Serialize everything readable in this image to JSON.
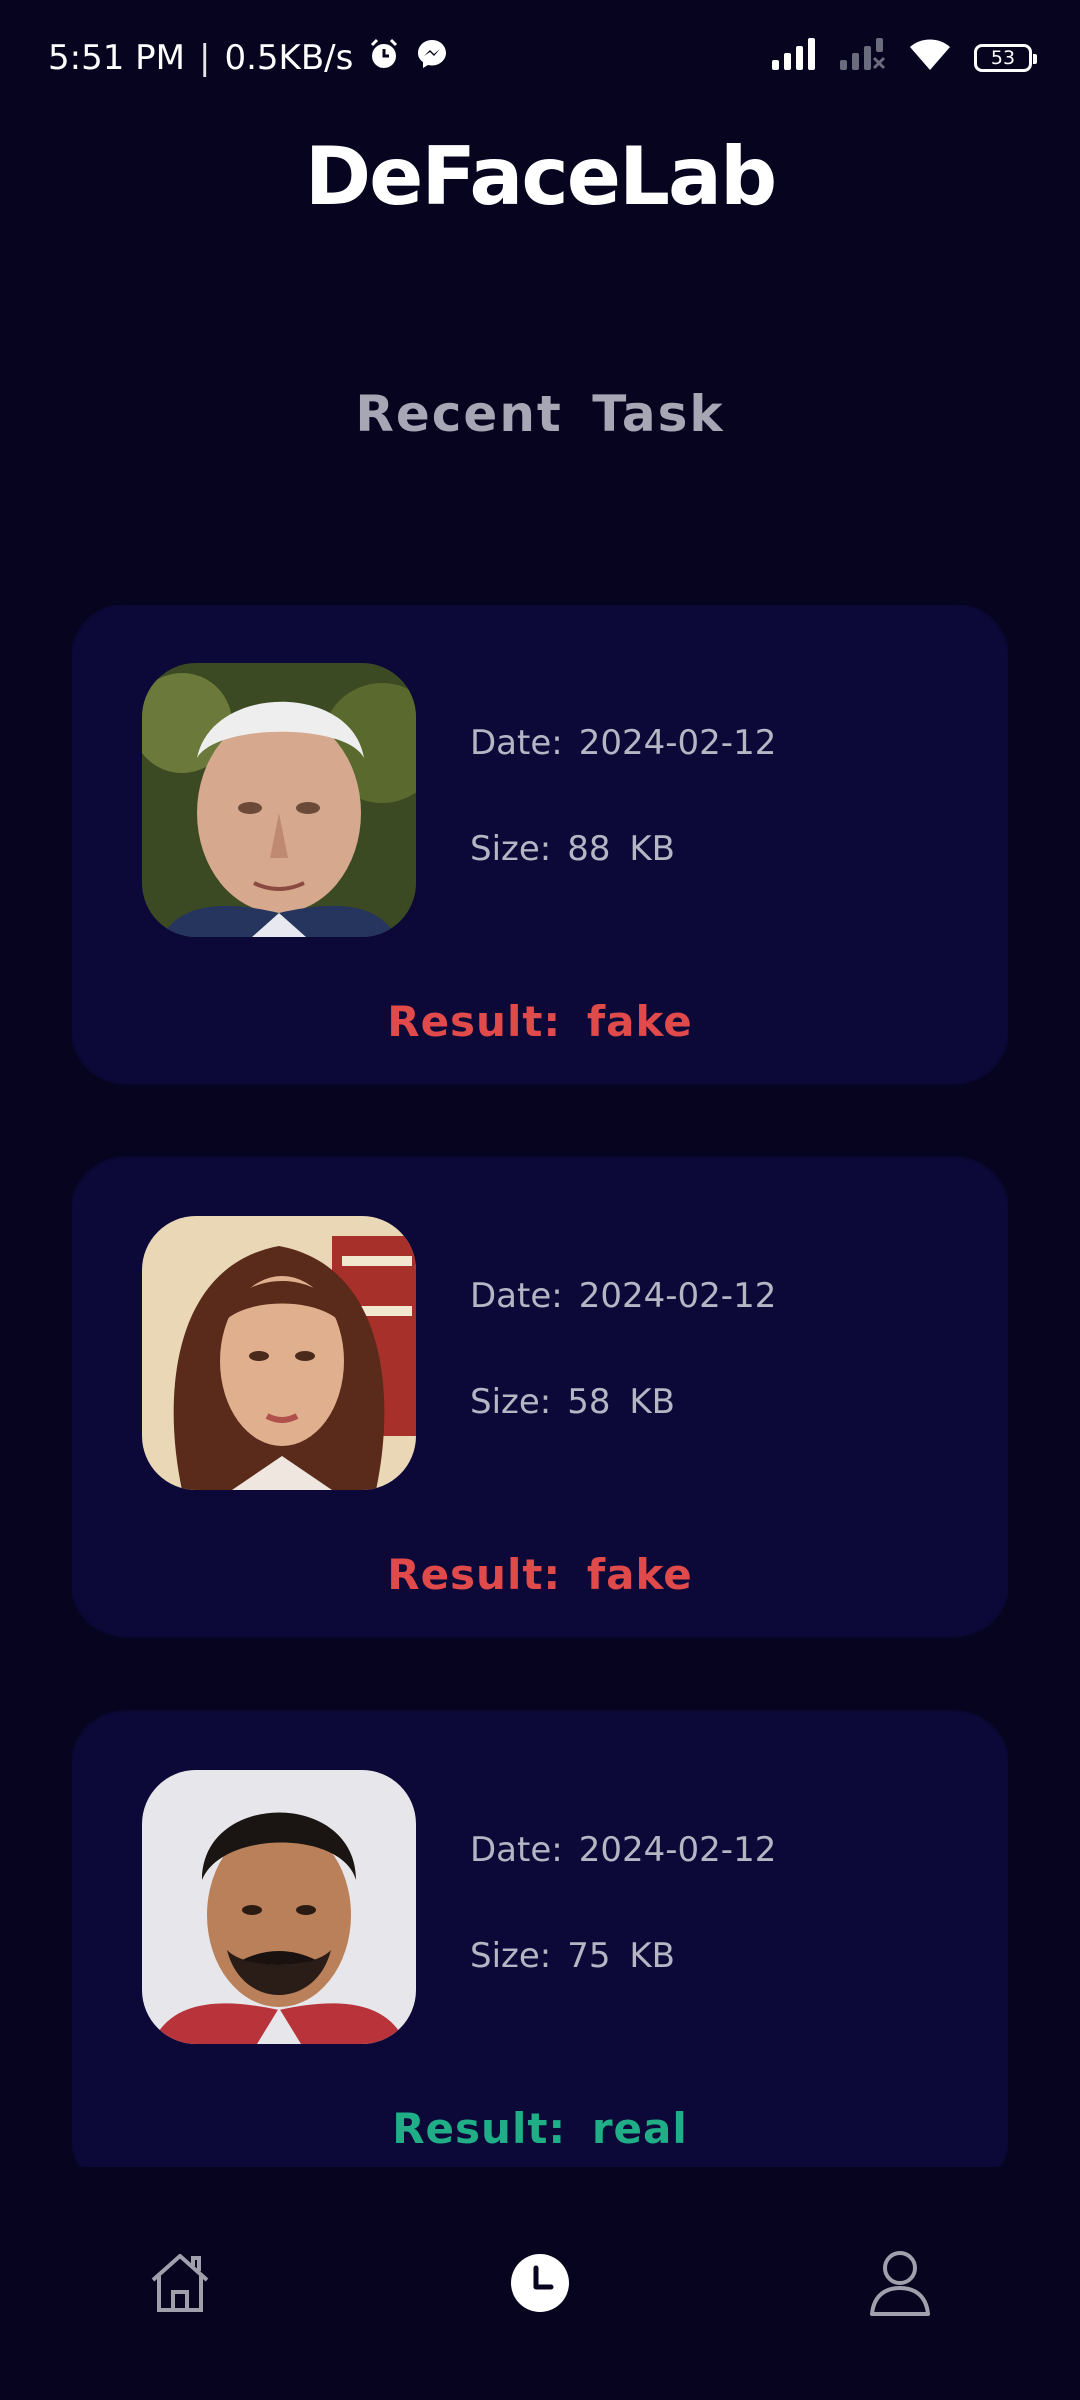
{
  "status_bar": {
    "time": "5:51 PM",
    "separator": "|",
    "net_speed": "0.5KB/s",
    "icons": [
      "alarm-icon",
      "messenger-icon",
      "signal-icon",
      "signal-off-icon",
      "wifi-icon"
    ],
    "battery": "53"
  },
  "app": {
    "title": "DeFaceLab"
  },
  "section": {
    "title": "Recent Task"
  },
  "labels": {
    "date": "Date:",
    "size": "Size:",
    "result": "Result:"
  },
  "tasks": [
    {
      "date": "2024-02-12",
      "size": "88 KB",
      "result": "fake",
      "result_color": "#e04a4a",
      "thumb_icon": "elderly-man-photo"
    },
    {
      "date": "2024-02-12",
      "size": "58 KB",
      "result": "fake",
      "result_color": "#e04a4a",
      "thumb_icon": "woman-portrait-photo"
    },
    {
      "date": "2024-02-12",
      "size": "75 KB",
      "result": "real",
      "result_color": "#1fae86",
      "thumb_icon": "bearded-man-photo"
    }
  ],
  "nav": {
    "items": [
      {
        "icon": "home-icon",
        "active": false
      },
      {
        "icon": "history-icon",
        "active": true
      },
      {
        "icon": "profile-icon",
        "active": false
      }
    ]
  },
  "colors": {
    "background": "#06041f",
    "card": "#0c0838",
    "fake": "#e04a4a",
    "real": "#1fae86"
  }
}
